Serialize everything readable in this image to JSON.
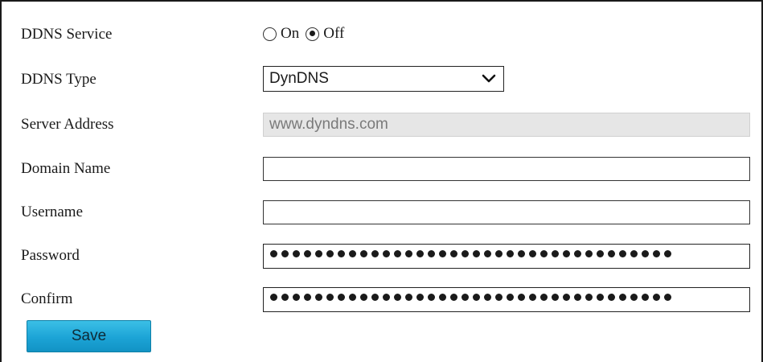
{
  "form": {
    "ddns_service": {
      "label": "DDNS Service",
      "options": [
        {
          "label": "On",
          "selected": false
        },
        {
          "label": "Off",
          "selected": true
        }
      ]
    },
    "ddns_type": {
      "label": "DDNS Type",
      "value": "DynDNS"
    },
    "server_address": {
      "label": "Server Address",
      "value": "www.dyndns.com",
      "disabled": true
    },
    "domain_name": {
      "label": "Domain Name",
      "value": ""
    },
    "username": {
      "label": "Username",
      "value": ""
    },
    "password": {
      "label": "Password",
      "masked_length": 36
    },
    "confirm": {
      "label": "Confirm",
      "masked_length": 36
    }
  },
  "actions": {
    "save_label": "Save",
    "save_color": "#1ca4d6"
  },
  "icons": {
    "select_arrow": "chevron-down-icon"
  }
}
